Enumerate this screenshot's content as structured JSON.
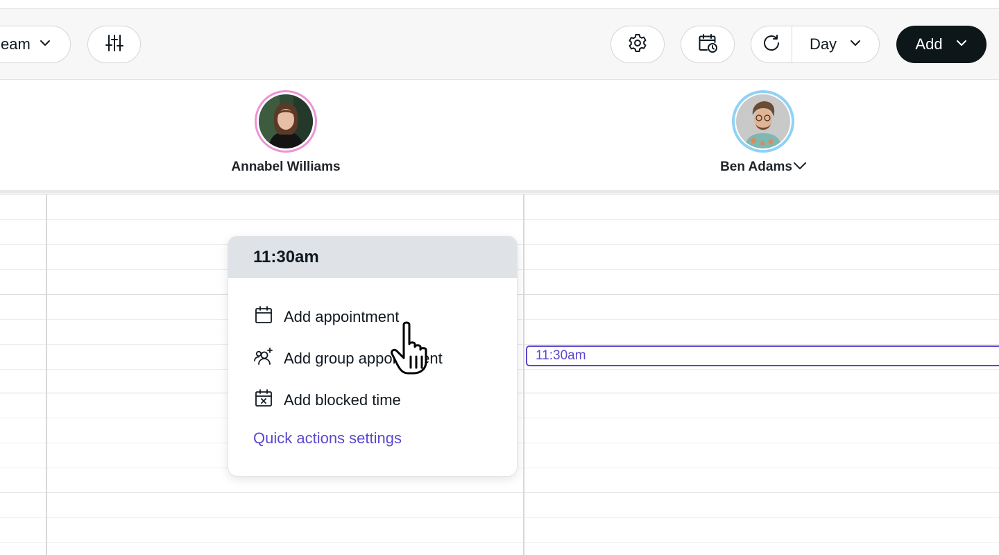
{
  "toolbar": {
    "team_filter_label": "eam",
    "view_label": "Day",
    "add_label": "Add",
    "icons": {
      "team_chevron": "chevron-down-icon",
      "filters": "sliders-icon",
      "settings": "gear-icon",
      "calendar_schedule": "calendar-clock-icon",
      "refresh": "refresh-icon"
    }
  },
  "staff": [
    {
      "name": "Annabel Williams",
      "ring_color": "#ee92d6"
    },
    {
      "name": "Ben Adams",
      "ring_color": "#8fd2f5",
      "has_dropdown": true
    }
  ],
  "grid": {
    "selected_slot_label": "11:30am",
    "highlight_color": "#5a48d0"
  },
  "popup": {
    "time": "11:30am",
    "items": [
      {
        "label": "Add appointment",
        "icon": "calendar-icon"
      },
      {
        "label": "Add group appointment",
        "icon": "group-add-icon"
      },
      {
        "label": "Add blocked time",
        "icon": "calendar-blocked-icon"
      }
    ],
    "settings_link": "Quick actions settings"
  },
  "colors": {
    "accent": "#5a48d0",
    "primary_button": "#0d1619",
    "popup_header": "#dfe3e8"
  }
}
